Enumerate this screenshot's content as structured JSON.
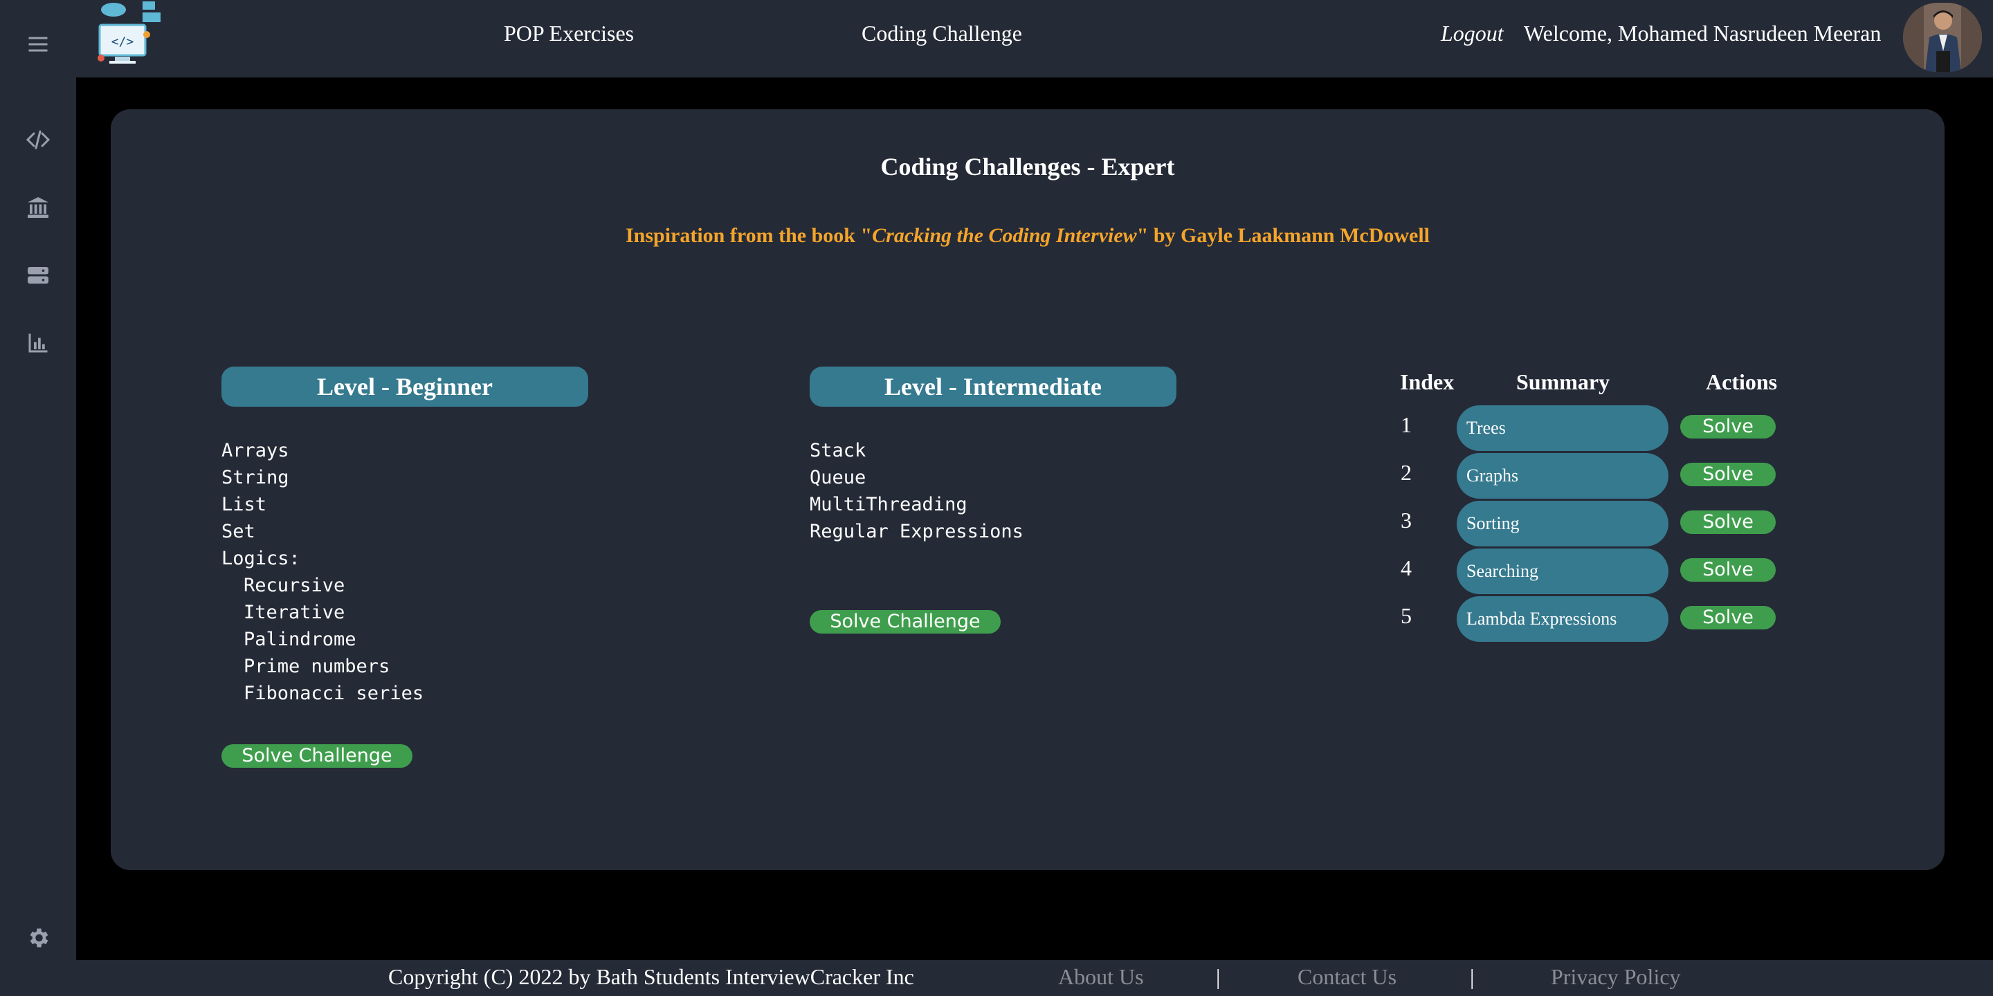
{
  "sidebar": {
    "icons": [
      "menu-icon",
      "code-icon",
      "bank-icon",
      "server-icon",
      "bar-chart-icon",
      "gear-icon"
    ]
  },
  "header": {
    "nav_pop": "POP Exercises",
    "nav_coding": "Coding Challenge",
    "logout": "Logout",
    "welcome": "Welcome, Mohamed Nasrudeen Meeran"
  },
  "main": {
    "title": "Coding Challenges - Expert",
    "inspiration_prefix": "Inspiration from the book \"",
    "inspiration_book": "Cracking the Coding Interview",
    "inspiration_suffix": "\" by Gayle Laakmann McDowell",
    "beginner": {
      "label": "Level - Beginner",
      "items": [
        "Arrays",
        "String",
        "List",
        "Set",
        "Logics:"
      ],
      "sub_items": [
        "Recursive",
        "Iterative",
        "Palindrome",
        "Prime numbers",
        "Fibonacci series"
      ],
      "button": "Solve Challenge"
    },
    "intermediate": {
      "label": "Level - Intermediate",
      "items": [
        "Stack",
        "Queue",
        "MultiThreading",
        "Regular Expressions"
      ],
      "button": "Solve Challenge"
    },
    "table": {
      "headers": [
        "Index",
        "Summary",
        "Actions"
      ],
      "rows": [
        {
          "index": "1",
          "summary": "Trees",
          "action": "Solve"
        },
        {
          "index": "2",
          "summary": "Graphs",
          "action": "Solve"
        },
        {
          "index": "3",
          "summary": "Sorting",
          "action": "Solve"
        },
        {
          "index": "4",
          "summary": "Searching",
          "action": "Solve"
        },
        {
          "index": "5",
          "summary": "Lambda Expressions",
          "action": "Solve"
        }
      ]
    }
  },
  "footer": {
    "copyright": "Copyright (C) 2022 by Bath Students InterviewCracker Inc",
    "about": "About Us",
    "contact": "Contact Us",
    "privacy": "Privacy Policy",
    "separator": "|"
  },
  "colors": {
    "panel": "#252a37",
    "accent_pill": "#367a8f",
    "button_green": "#3f9e4d",
    "highlight": "#f5a52a"
  }
}
